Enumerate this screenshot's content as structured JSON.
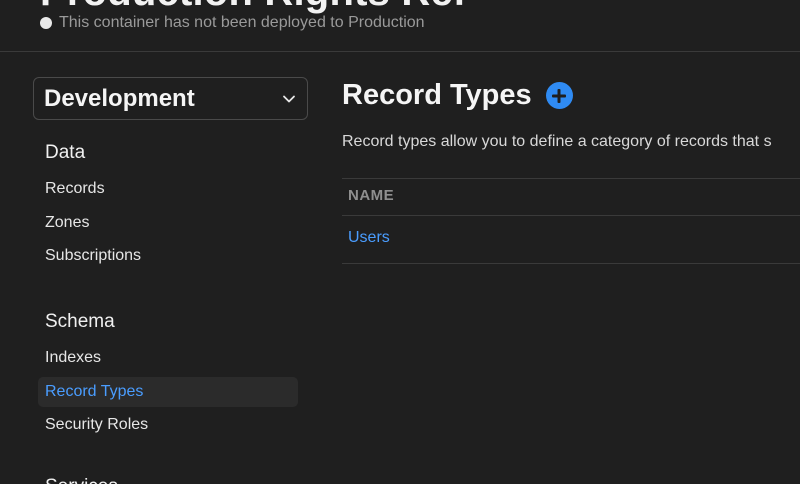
{
  "header": {
    "title": "Production Rights Ref",
    "deploy_status": "This container has not been deployed to Production"
  },
  "sidebar": {
    "environment_select": {
      "value": "Development"
    },
    "sections": [
      {
        "title": "Data",
        "items": [
          {
            "label": "Records",
            "active": false
          },
          {
            "label": "Zones",
            "active": false
          },
          {
            "label": "Subscriptions",
            "active": false
          }
        ]
      },
      {
        "title": "Schema",
        "items": [
          {
            "label": "Indexes",
            "active": false
          },
          {
            "label": "Record Types",
            "active": true
          },
          {
            "label": "Security Roles",
            "active": false
          }
        ]
      },
      {
        "title": "Services",
        "items": []
      }
    ]
  },
  "main": {
    "title": "Record Types",
    "description": "Record types allow you to define a category of records that s",
    "table": {
      "columns": [
        "NAME"
      ],
      "rows": [
        [
          "Users"
        ]
      ]
    }
  },
  "colors": {
    "background": "#1f1f1f",
    "accent": "#4a9dff",
    "add_button": "#2f8bf3"
  }
}
